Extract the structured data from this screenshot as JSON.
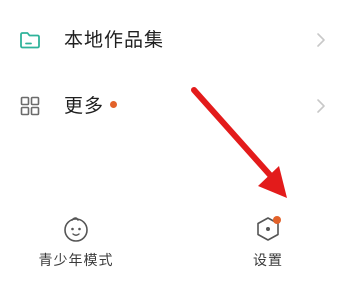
{
  "colors": {
    "accent": "#e3622a",
    "folder_icon": "#2fb39a",
    "chevron": "#c8c8c8",
    "arrow": "#e31b1b"
  },
  "menu": {
    "items": [
      {
        "label": "本地作品集",
        "icon": "folder-icon",
        "has_badge": false
      },
      {
        "label": "更多",
        "icon": "grid-icon",
        "has_badge": true
      }
    ]
  },
  "bottom_bar": {
    "tabs": [
      {
        "label": "青少年模式",
        "icon": "face-icon",
        "has_badge": false
      },
      {
        "label": "设置",
        "icon": "hexagon-settings-icon",
        "has_badge": true
      }
    ]
  }
}
